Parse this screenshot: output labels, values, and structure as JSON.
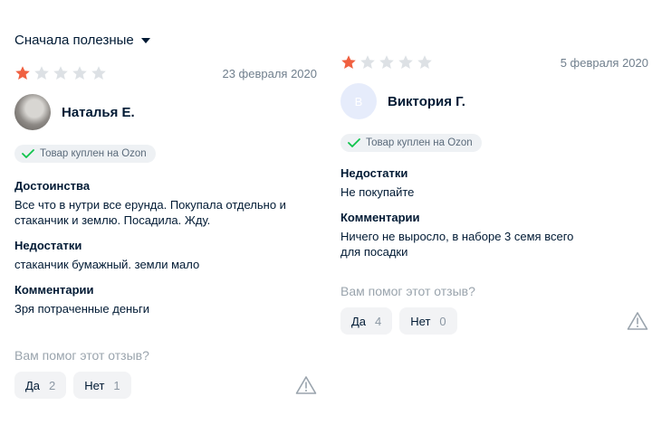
{
  "sort": {
    "label": "Сначала полезные"
  },
  "colors": {
    "star_filled": "#f06040",
    "star_empty": "#dde1e5",
    "check": "#10c44c"
  },
  "reviews": [
    {
      "rating": 1,
      "max_rating": 5,
      "date": "23 февраля 2020",
      "author": "Наталья Е.",
      "avatar_letter": "",
      "badge": "Товар куплен на Ozon",
      "sections": [
        {
          "title": "Достоинства",
          "text": "Все что в нутри все ерунда. Покупала отдельно и стаканчик и землю. Посадила. Жду."
        },
        {
          "title": "Недостатки",
          "text": "стаканчик бумажный. земли мало"
        },
        {
          "title": "Комментарии",
          "text": "Зря потраченные деньги"
        }
      ],
      "helpful_question": "Вам помог этот отзыв?",
      "yes_label": "Да",
      "yes_count": "2",
      "no_label": "Нет",
      "no_count": "1"
    },
    {
      "rating": 1,
      "max_rating": 5,
      "date": "5 февраля 2020",
      "author": "Виктория Г.",
      "avatar_letter": "В",
      "badge": "Товар куплен на Ozon",
      "sections": [
        {
          "title": "Недостатки",
          "text": "Не покупайте"
        },
        {
          "title": "Комментарии",
          "text": "Ничего не выросло, в наборе 3 семя всего для посадки"
        }
      ],
      "helpful_question": "Вам помог этот отзыв?",
      "yes_label": "Да",
      "yes_count": "4",
      "no_label": "Нет",
      "no_count": "0"
    }
  ]
}
